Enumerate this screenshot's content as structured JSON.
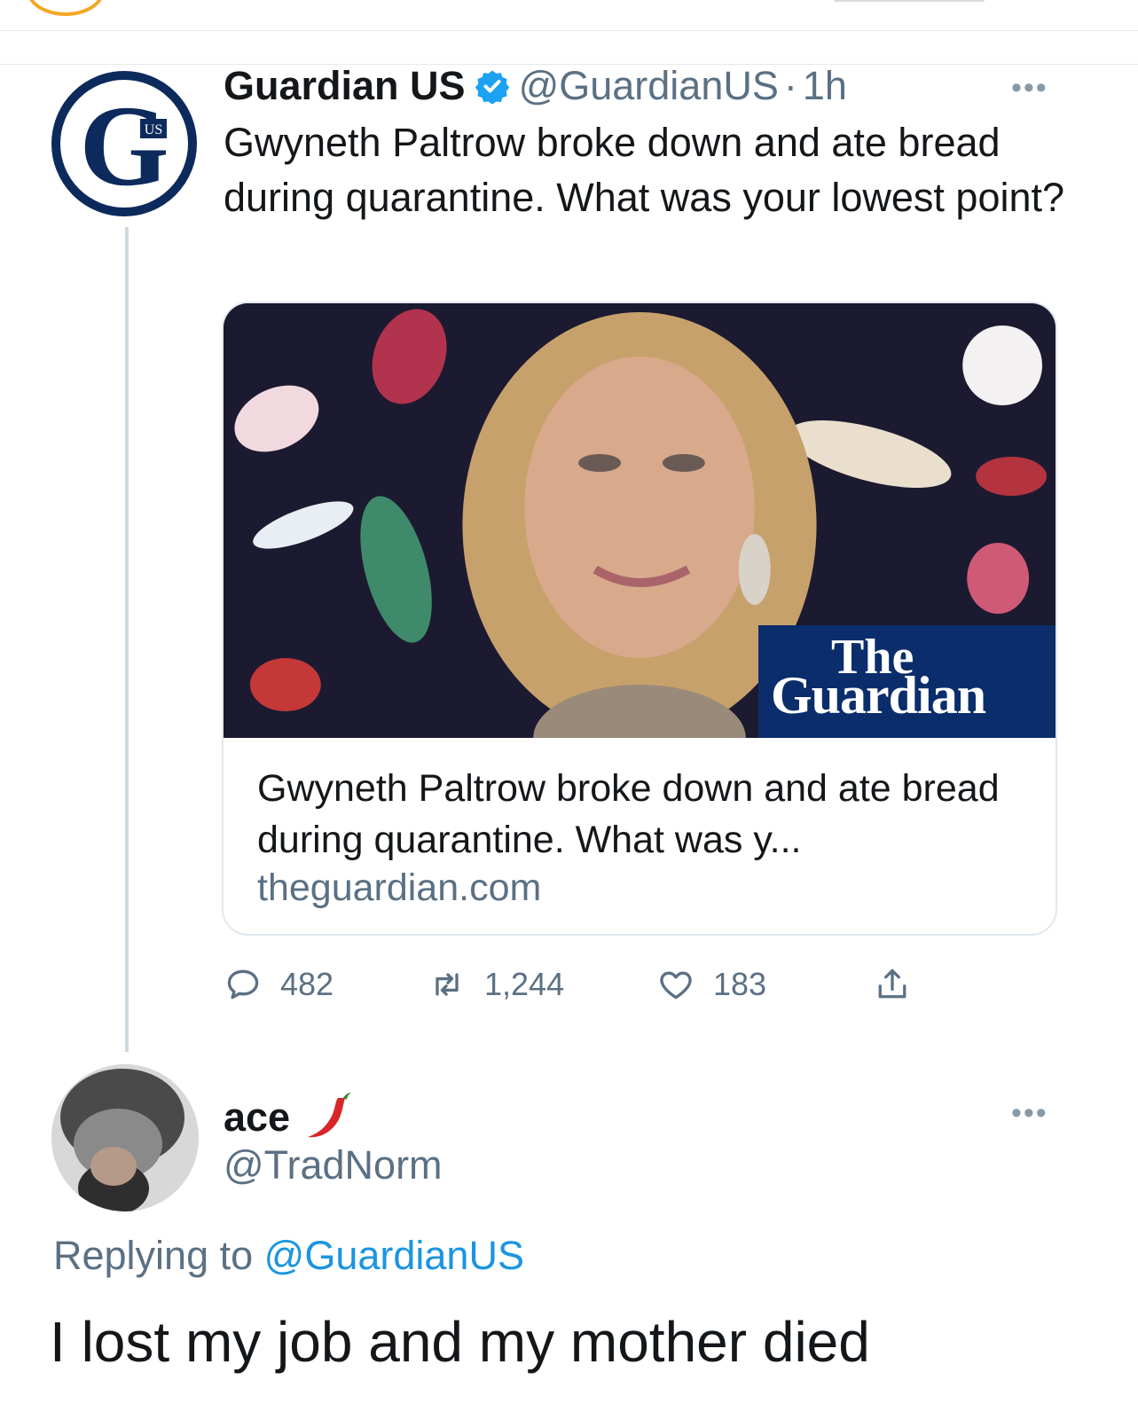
{
  "tweet": {
    "author_name": "Guardian US",
    "handle": "@GuardianUS",
    "separator": "·",
    "time": "1h",
    "text": "Gwyneth Paltrow broke down and ate bread during quarantine. What was your lowest point?",
    "more_label": "•••",
    "avatar_letters": "US",
    "card": {
      "logo_line1": "The",
      "logo_line2": "Guardian",
      "title": "Gwyneth Paltrow broke down and ate bread during quarantine. What was y...",
      "domain": "theguardian.com"
    },
    "actions": {
      "replies": "482",
      "retweets": "1,244",
      "likes": "183"
    }
  },
  "reply": {
    "author_name": "ace",
    "handle": "@TradNorm",
    "more_label": "•••",
    "replying_prefix": "Replying to",
    "replying_mention": "@GuardianUS",
    "text": "I lost my job and my mother died"
  },
  "colors": {
    "guardian_navy": "#0b2d6b",
    "muted_text": "#5b7083",
    "link_blue": "#1b95e0",
    "verified_blue": "#1da1f2"
  }
}
